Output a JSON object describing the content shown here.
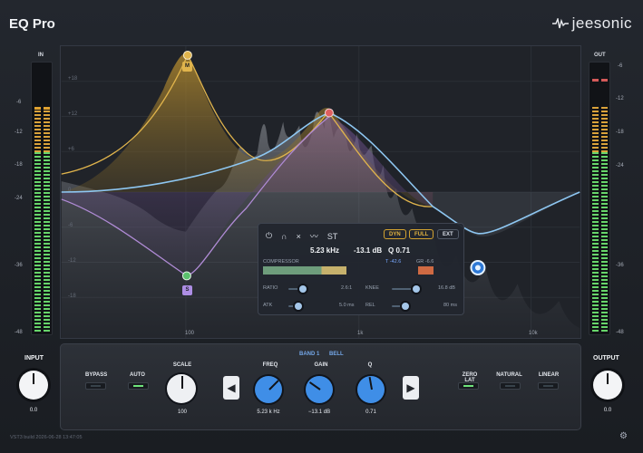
{
  "app": {
    "title": "EQ Pro",
    "brand": "jeesonic"
  },
  "meters": {
    "input_label": "IN",
    "output_label": "OUT",
    "scale": [
      "-6",
      "-12",
      "-18",
      "-24",
      "-36",
      "-48"
    ]
  },
  "graph": {
    "db_ticks": [
      "+18",
      "+12",
      "+6",
      "0",
      "-6",
      "-12",
      "-18"
    ],
    "freq_ticks": [
      "100",
      "1k",
      "10k"
    ],
    "nodes": [
      "M",
      "S"
    ]
  },
  "popup": {
    "mode_icons": [
      "⏻",
      "∩",
      "×",
      "〰",
      "ST"
    ],
    "dyn": "DYN",
    "full": "FULL",
    "ext": "EXT",
    "freq": "5.23 kHz",
    "gain": "-13.1 dB",
    "q": "Q 0.71",
    "compressor": "COMPRESSOR",
    "threshold": "T -42.6",
    "gr": "GR -6.6",
    "ratio_label": "RATIO",
    "ratio_value": "2.6:1",
    "knee_label": "KNEE",
    "knee_value": "16.8 dB",
    "atk_label": "ATK",
    "atk_value": "5.0 ms",
    "rel_label": "REL",
    "rel_value": "80 ms"
  },
  "panel": {
    "band": "BAND 1",
    "type": "BELL",
    "bypass": "BYPASS",
    "auto": "AUTO",
    "scale": "SCALE",
    "scale_value": "100",
    "freq": "FREQ",
    "freq_value": "5.23 k Hz",
    "gain": "GAIN",
    "gain_value": "−13.1 dB",
    "q": "Q",
    "q_value": "0.71",
    "zero_lat": "ZERO LAT",
    "natural": "NATURAL",
    "linear": "LINEAR"
  },
  "input": {
    "label": "INPUT",
    "value": "0.0"
  },
  "output": {
    "label": "OUTPUT",
    "value": "0.0"
  },
  "status": "VST3 build 2026-06-28 13:47:05",
  "colors": {
    "accent": "#3f8ee7",
    "curve_yellow": "#e0b44c",
    "curve_blue": "#8ec7f2",
    "curve_purple": "#b08bd6",
    "meter_green": "#67d56a"
  }
}
